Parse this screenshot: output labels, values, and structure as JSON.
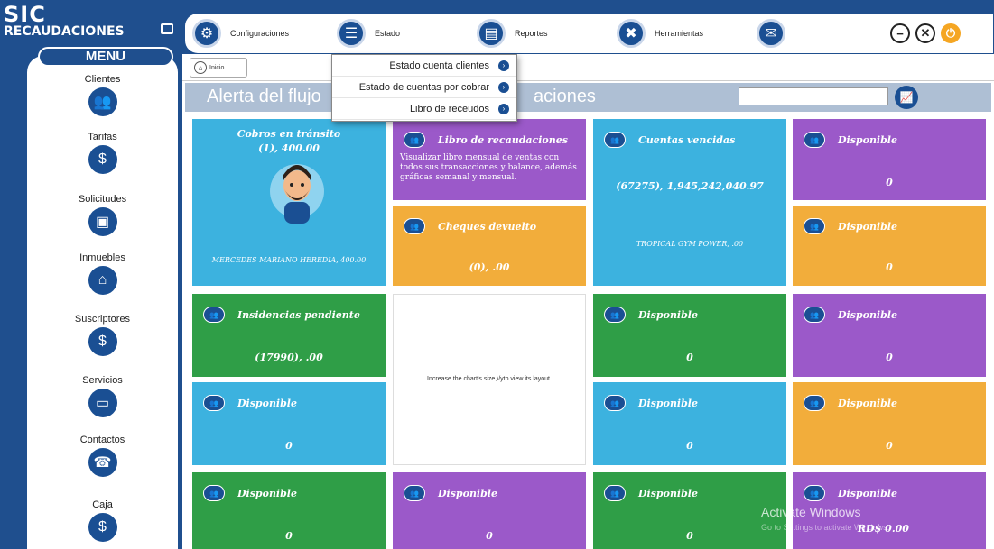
{
  "logo": {
    "line1": "SIC",
    "line2": "RECAUDACIONES"
  },
  "topbar": {
    "items": [
      {
        "label": "Configuraciones",
        "icon": "gear-icon"
      },
      {
        "label": "Estado",
        "icon": "document-icon"
      },
      {
        "label": "Reportes",
        "icon": "report-icon"
      },
      {
        "label": "Herramientas",
        "icon": "tools-icon"
      },
      {
        "label": "",
        "icon": "mail-icon"
      }
    ]
  },
  "sidebar": {
    "header": "MENU",
    "items": [
      {
        "label": "Clientes",
        "icon": "clients-icon"
      },
      {
        "label": "Tarifas",
        "icon": "rates-icon"
      },
      {
        "label": "Solicitudes",
        "icon": "requests-icon"
      },
      {
        "label": "Inmuebles",
        "icon": "property-icon"
      },
      {
        "label": "Suscriptores",
        "icon": "subscribers-icon"
      },
      {
        "label": "Servicios",
        "icon": "services-icon"
      },
      {
        "label": "Contactos",
        "icon": "contacts-icon"
      },
      {
        "label": "Caja",
        "icon": "cash-icon"
      }
    ]
  },
  "tab": {
    "label": "Inicio"
  },
  "alert": {
    "title": "Alerta del flujo",
    "title_tail": "aciones",
    "search_placeholder": ""
  },
  "dropdown": {
    "items": [
      "Estado cuenta clientes",
      "Estado de cuentas por cobrar",
      "Libro de receudos"
    ]
  },
  "tiles": {
    "cobros": {
      "title": "Cobros en tránsito",
      "value": "(1), 400.00",
      "footer": "MERCEDES MARIANO HEREDIA, 400.00"
    },
    "libro": {
      "title": "Libro de recaudaciones",
      "desc": "Visualizar libro mensual de ventas con todos sus transacciones y balance, además gráficas semanal y mensual."
    },
    "cuentas": {
      "title": "Cuentas vencidas",
      "value": "(67275), 1,945,242,040.97",
      "footer": "TROPICAL GYM POWER, .00"
    },
    "disp_r1": {
      "title": "Disponible",
      "value": "0"
    },
    "cheques": {
      "title": "Cheques devuelto",
      "value": "(0), .00"
    },
    "disp_r2": {
      "title": "Disponible",
      "value": "0"
    },
    "insidencias": {
      "title": "Insidencias pendiente",
      "value": "(17990), .00"
    },
    "chart_msg": {
      "text": "Increase the chart's size,\\/yto view its layout."
    },
    "disp_g1": {
      "title": "Disponible",
      "value": "0"
    },
    "disp_p3": {
      "title": "Disponible",
      "value": "0"
    },
    "disp_b4": {
      "title": "Disponible",
      "value": "0"
    },
    "disp_b5": {
      "title": "Disponible",
      "value": "0"
    },
    "disp_o6": {
      "title": "Disponible",
      "value": "0"
    },
    "disp_g7": {
      "title": "Disponible",
      "value": "0"
    },
    "disp_p8": {
      "title": "Disponible",
      "value": "0"
    },
    "disp_g9": {
      "title": "Disponible",
      "value": "0"
    },
    "disp_p10": {
      "title": "Disponible",
      "value": "0"
    }
  },
  "footer": {
    "watermark": "Activate Windows",
    "watermark_sub": "Go to Settings to activate Windows.",
    "total": "RD$ 0.00"
  }
}
